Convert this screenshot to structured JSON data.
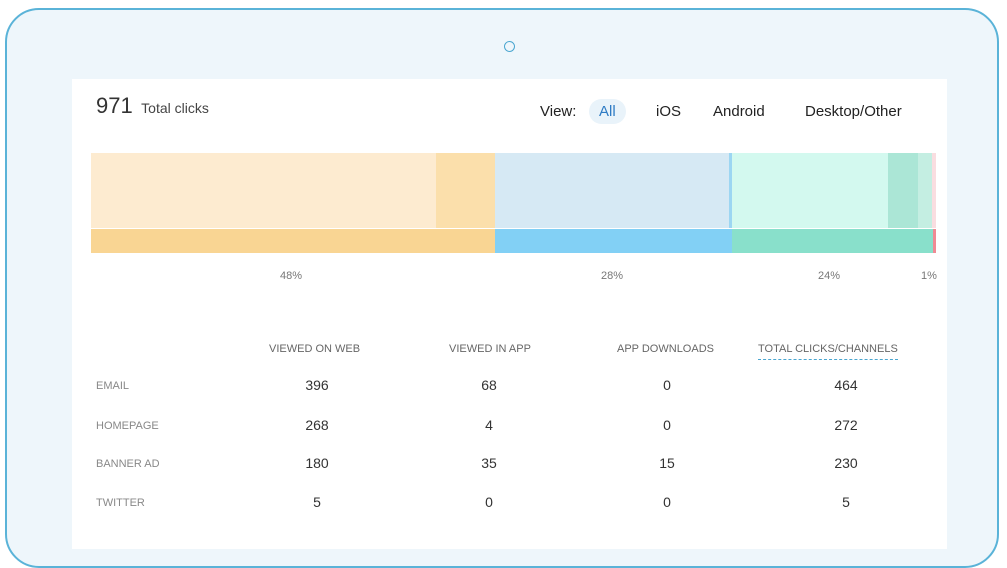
{
  "summary": {
    "total_count": "971",
    "total_label": "Total clicks"
  },
  "view_filter": {
    "label": "View:",
    "options": [
      {
        "label": "All",
        "active": true
      },
      {
        "label": "iOS",
        "active": false
      },
      {
        "label": "Android",
        "active": false
      },
      {
        "label": "Desktop/Other",
        "active": false
      }
    ]
  },
  "distribution": {
    "segments": [
      {
        "percent_label": "48%",
        "share": 48,
        "color_light": "#fdebd0",
        "color_dark": "#f9d593"
      },
      {
        "percent_label": "28%",
        "share": 28,
        "color_light": "#d6e9f4",
        "color_dark": "#82d0f5"
      },
      {
        "percent_label": "24%",
        "share": 24,
        "color_light": "#d3f9ef",
        "color_dark": "#89e0cb"
      },
      {
        "percent_label": "1%",
        "share": 1,
        "color_light": "#f9dde0",
        "color_dark": "#f08a94"
      }
    ]
  },
  "table": {
    "columns": [
      "VIEWED ON WEB",
      "VIEWED IN APP",
      "APP DOWNLOADS",
      "TOTAL CLICKS/CHANNELS"
    ],
    "rows": [
      {
        "label": "EMAIL",
        "values": [
          "396",
          "68",
          "0",
          "464"
        ]
      },
      {
        "label": "HOMEPAGE",
        "values": [
          "268",
          "4",
          "0",
          "272"
        ]
      },
      {
        "label": "BANNER AD",
        "values": [
          "180",
          "35",
          "15",
          "230"
        ]
      },
      {
        "label": "TWITTER",
        "values": [
          "5",
          "0",
          "0",
          "5"
        ]
      }
    ]
  }
}
